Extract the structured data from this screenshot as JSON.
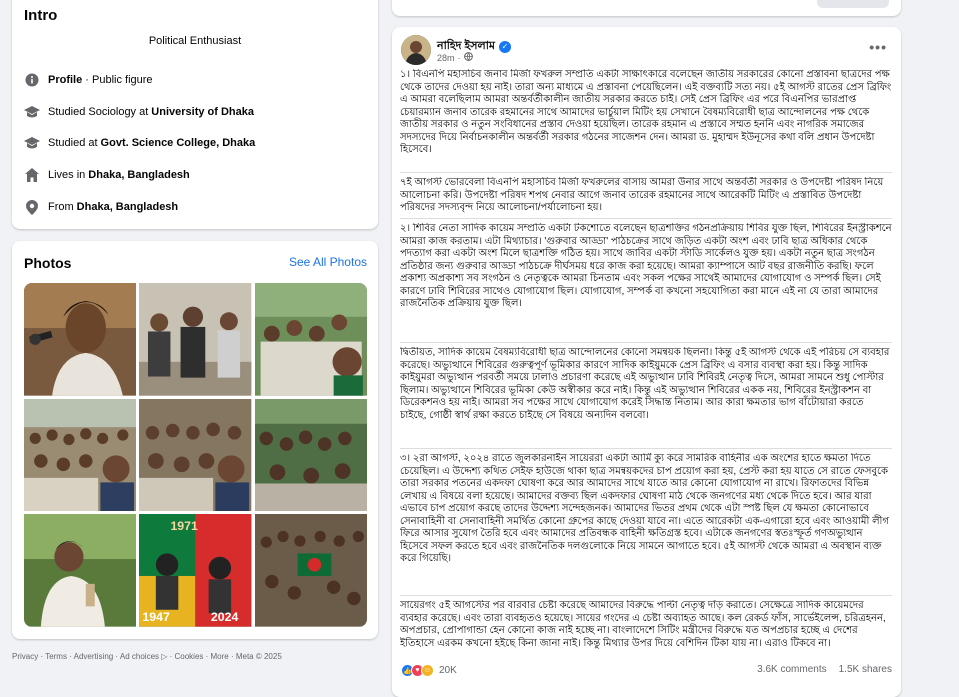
{
  "intro": {
    "title": "Intro",
    "bio": "Political Enthusiast",
    "rows": [
      {
        "icon": "info-icon",
        "pre": "",
        "bold": "Profile",
        "post": " · Public figure"
      },
      {
        "icon": "graduation-cap-icon",
        "pre": "Studied Sociology at",
        "bold": "University of Dhaka",
        "post": ""
      },
      {
        "icon": "graduation-cap-icon",
        "pre": "Studied at",
        "bold": "Govt. Science College, Dhaka",
        "post": ""
      },
      {
        "icon": "home-icon",
        "pre": "Lives in",
        "bold": "Dhaka, Bangladesh",
        "post": ""
      },
      {
        "icon": "location-pin-icon",
        "pre": "From",
        "bold": "Dhaka, Bangladesh",
        "post": ""
      }
    ]
  },
  "photos": {
    "title": "Photos",
    "see_all": "See All Photos",
    "year_left": "1947",
    "year_right": "2024",
    "year_top": "1971"
  },
  "footer": "Privacy · Terms · Advertising · Ad choices ▷ · Cookies · More · Meta © 2025",
  "post": {
    "author": "নাহিদ ইসলাম",
    "time": "28m",
    "time_sep": "·",
    "paragraphs": [
      "১। বিএনপি মহাসচিব জনাব মির্জা ফখরুল সম্প্রতি একটা সাক্ষাৎকারে বলেছেন জাতীয় সরকারের কোনো প্রস্তাবনা ছাত্রদের পক্ষ থেকে তাদের দেওয়া হয় নাই। তারা অন্য মাধ্যমে এ প্রস্তাবনা পেয়েছিলেন। এই বক্তব্যটি সত্য নয়। ৫ই আগস্ট রাতের প্রেস ব্রিফিং এ আমরা বলেছিলাম আমরা অন্তর্বর্তীকালীন জাতীয় সরকার করতে চাই। সেই প্রেস ব্রিফিং এর পরে বিএনপির ভারপ্রাপ্ত চেয়ারম্যান জনাব তারেক রহমানের সাথে আমাদের ভার্চুয়াল মিটিং হয় সেখানে বৈষম্যবিরোধী ছাত্র আন্দোলনের পক্ষ থেকে জাতীয় সরকার ও নতুন সংবিধানের প্রস্তাব দেওয়া হয়েছিল। তারেক রহমান এ প্রস্তাবে সম্মত হননি এবং নাগরিক সমাজের সদস্যদের দিয়ে নির্বাচনকালীন অন্তর্বর্তী সরকার গঠনের সাজেশন দেন। আমরা ড. মুহাম্মদ ইউনূসের কথা বলি প্রধান উপদেষ্টা হিসেবে।",
      "৭ই আগস্ট ভোরবেলা বিএনপি মহাসচিব মির্জা ফখরুলের বাসায় আমরা উনার সাথে অন্তর্বর্তী সরকার ও উপদেষ্টা পরিষদ নিয়ে আলোচনা করি। উপদেষ্টা পরিষদ শপথ নেবার আগে জনাব তারেক রহমানের সাথে আরেকটি মিটিং এ প্রস্তাবিত উপদেষ্টা পরিষদের সদস্যবৃন্দ নিয়ে আলোচনা/পর্যালোচনা হয়।",
      "২। শিবির নেতা সাদিক কায়েম সম্প্রতি একটা টকশোতে বলেছেন ছাত্রশক্তির গঠনপ্রক্রিয়ায় শিবির যুক্ত ছিল, শিবিরের ইনস্ট্রাকশনে আমরা কাজ করতাম। এটা মিথ্যাচার। 'গুরুবার আড্ডা' পাঠচক্রের সাথে জড়িত একটা অংশ এবং ঢাবি ছাত্র অধিকার থেকে পদত্যাগ করা একটা অংশ মিলে ছাত্রশক্তি গঠিত হয়। সাথে জাবির একটা স্টাডি সার্কেলও যুক্ত হয়। একটা নতুন ছাত্র সংগঠন প্রতিষ্ঠার জন্য গুরুবার আড্ডা পাঠচক্রে দীর্ঘসময় ধরে কাজ করা হয়েছে। আমরা ক্যাম্পাসে আট বছর রাজনীতি করছি। ফলে প্রকাশ্য অপ্রকাশ্য সব সংগঠন ও নেতৃত্বকে আমরা চিনতাম এবং সকল পক্ষের সাথেই আমাদের যোগাযোগ ও সম্পর্ক ছিল। সেই কারণে ঢাবি শিবিরের সাথেও যোগাযোগ ছিল। যোগাযোগ, সম্পর্ক বা কখনো সহযোগিতা করা মানে এই না যে তারা আমাদের রাজনৈতিক প্রক্রিয়ায় যুক্ত ছিল।",
      "দ্বিতীয়ত, সাদিক কায়েম বৈষম্যবিরোধী ছাত্র আন্দোলনের কোনো সমন্বয়ক ছিলনা। কিন্তু ৫ই আগস্ট থেকে এই পরিচয় সে ব্যবহার করেছে। অভ্যুত্থানে শিবিরের গুরুত্বপূর্ণ ভূমিকার কারণে সাদিক কাইয়ুমকে প্রেস ব্রিফিং এ বসার ব্যবস্থা করা হয়। কিন্তু সাদিক কাইয়ুমরা অভ্যুত্থান পরবর্তী সময়ে ঢালাও প্রচারণা করেছে এই অভ্যুত্থান ঢাবি শিবিরই নেতৃত্ব দিসে, আমরা সামনে শুধু পোস্টার ছিলাম। অভ্যুত্থানে শিবিরের ভূমিকা কেউ অস্বীকার করে নাই। কিন্তু এই অভ্যুত্থান শিবিরের একক নয়, শিবিরের ইনস্ট্রাকশন বা ডিরেকশনও হয় নাই। আমরা সব পক্ষের সাথে যোগাযোগ করেই সিদ্ধান্ত নিতাম। আর কারা ক্ষমতার ভাগ বাঁটোয়ারা করতে চাইছে, গোষ্ঠী স্বার্থ রক্ষা করতে চাইছে সে বিষয়ে অন্যদিন বলবো।",
      "৩। ২রা আগস্ট, ২০২৪ রাতে জুলকারনাইন সায়েররা একটা আর্মি ক্যু করে সামরিক বাহিনীর এক অংশের হাতে ক্ষমতা দিতে চেয়েছিল। এ উদ্দেশ্য কথিত সেইফ হাউজে থাকা ছাত্র সমন্বয়কদের চাপ প্রয়োগ করা হয়, প্রেস্ট করা হয় যাতে সে রাতে ফেসবুকে তারা সরকার পতনের একদফা ঘোষণা করে আর আমাদের সাথে যাতে আর কোনো যোগাযোগ না রাখে। রিফাতদের বিভিন্ন লেখায় এ বিষয়ে বলা হয়েছে। আমাদের বক্তব্য ছিল একদফার ঘোষণা মাঠ থেকে জনগণের মধ্য থেকে দিতে হবে। আর যারা এভাবে চাপ প্রয়োগ করছে তাদের উদ্দেশ্য সন্দেহজনক। আমাদের ভিতর প্রথম থেকে এটা স্পষ্ট ছিল যে ক্ষমতা কোনোভাবে সেনাবাহিনী বা সেনাবাহিনী সমর্থিত কোনো গ্রুপের কাছে দেওয়া যাবে না। এতে আরেকটা এক-এগারো হবে এবং আওয়ামী লীগ ফিরে আসার সুযোগ তৈরি হবে এবং আমাদের প্রতিবন্ধক বাহিনী ক্ষতিগ্রস্ত হবে। এটাকে জনগণের স্বতঃস্ফূর্ত গণঅভ্যুত্থান হিসেবে সফল করতে হবে এবং রাজনৈতিক দলগুলোকে নিয়ে সামনে আগাতে হবে। ৫ই আগস্ট থেকে আমরা এ অবস্থান ব্যক্ত করে গিয়েছি।",
      "সায়েরগং ৫ই আগস্টের পর বারবার চেষ্টা করেছে আমাদের বিরুদ্ধে পাল্টা নেতৃত্ব দাঁড় করাতে। সেক্ষেত্রে সাদিক কায়েমদের ব্যবহার করেছে। এবং তারা ব্যবহৃতও হয়েছে। সায়ের গংদের এ চেষ্টা অব্যাহত আছে। কল রেকর্ড ফাঁস, সার্ভেইলেন্স, চরিত্রহনন, অপপ্রচার, প্রোপাগান্ডা হেন কোনো কাজ নাই হচ্ছে না। বাংলাদেশে সিটিং মন্ত্রীদের বিরুদ্ধে যত অপপ্রচার হচ্ছে এ দেশের ইতিহাসে এরকম কখনো হইছে কিনা জানা নাই। কিন্তু মিথ্যার উপর দিয়ে বেশিদিন টিকা যায় না। এরাও টিকবে না।"
    ],
    "reaction_count": "20K",
    "comments": "3.6K comments",
    "shares": "1.5K shares"
  },
  "colors": {
    "accent": "#1b74e4",
    "verified": "#1877f2",
    "like": "#1877f2",
    "love": "#f33e58",
    "haha": "#f7b125"
  }
}
